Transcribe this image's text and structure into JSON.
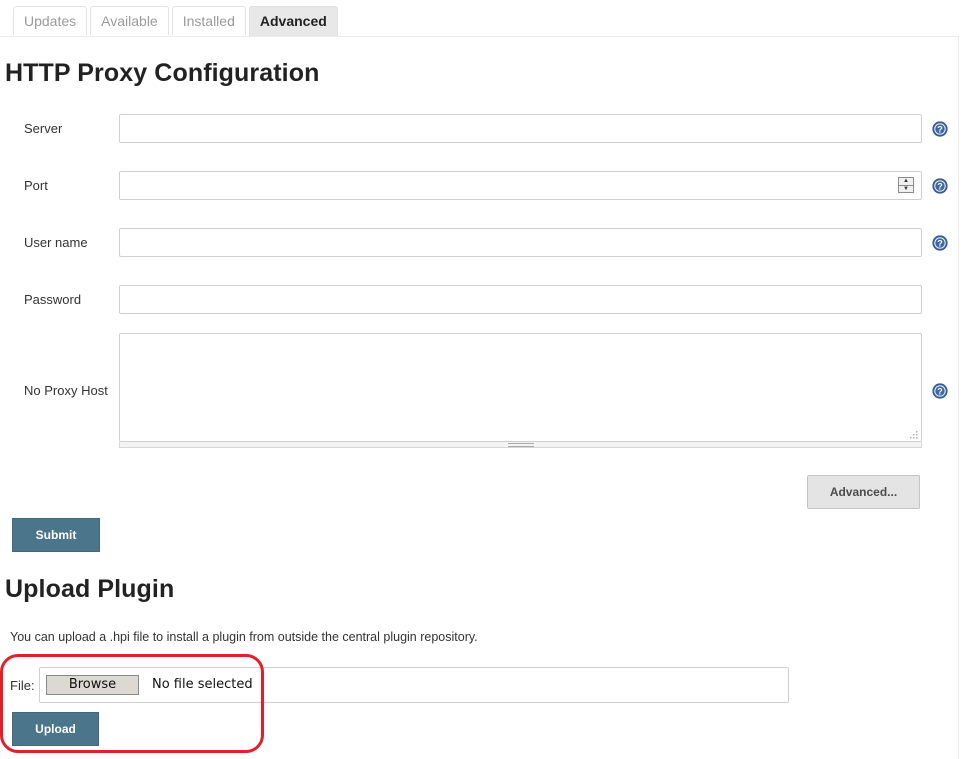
{
  "tabs": [
    {
      "label": "Updates",
      "active": false
    },
    {
      "label": "Available",
      "active": false
    },
    {
      "label": "Installed",
      "active": false
    },
    {
      "label": "Advanced",
      "active": true
    }
  ],
  "proxy": {
    "title": "HTTP Proxy Configuration",
    "server_label": "Server",
    "server_value": "",
    "port_label": "Port",
    "port_value": "",
    "username_label": "User name",
    "username_value": "",
    "password_label": "Password",
    "password_value": "",
    "no_proxy_label": "No Proxy Host",
    "no_proxy_value": "",
    "advanced_button": "Advanced...",
    "submit_button": "Submit"
  },
  "upload": {
    "title": "Upload Plugin",
    "description": "You can upload a .hpi file to install a plugin from outside the central plugin repository.",
    "file_label": "File:",
    "browse_button": "Browse",
    "file_status": "No file selected",
    "upload_button": "Upload"
  },
  "icons": {
    "help": "help-icon",
    "spinner": "number-spinner-icon"
  },
  "colors": {
    "primary_button": "#4b758b",
    "help_icon": "#3f67a8",
    "annotation": "#e0202a",
    "active_tab": "#e8e8e8"
  }
}
